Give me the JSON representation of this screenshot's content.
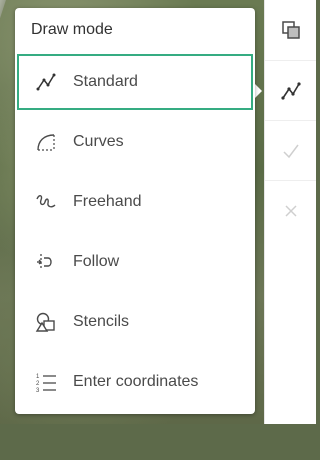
{
  "panel": {
    "title": "Draw mode",
    "items": [
      {
        "label": "Standard",
        "icon": "standard-line-icon",
        "selected": true
      },
      {
        "label": "Curves",
        "icon": "curves-icon",
        "selected": false
      },
      {
        "label": "Freehand",
        "icon": "freehand-icon",
        "selected": false
      },
      {
        "label": "Follow",
        "icon": "follow-icon",
        "selected": false
      },
      {
        "label": "Stencils",
        "icon": "stencils-icon",
        "selected": false
      },
      {
        "label": "Enter coordinates",
        "icon": "enter-coordinates-icon",
        "selected": false
      }
    ]
  },
  "toolbar": {
    "tools": [
      {
        "icon": "copy-icon",
        "enabled": true
      },
      {
        "icon": "draw-mode-icon",
        "enabled": true
      },
      {
        "icon": "checkmark-icon",
        "enabled": false
      },
      {
        "icon": "close-icon",
        "enabled": false
      }
    ]
  },
  "colors": {
    "selected_border": "#35ac82",
    "text": "#4a4a4a",
    "disabled_icon": "#cfcfcf"
  }
}
